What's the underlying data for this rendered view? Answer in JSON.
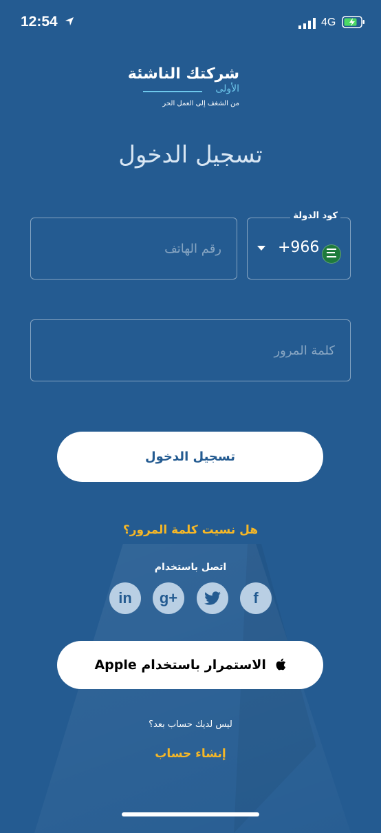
{
  "status_bar": {
    "time": "12:54",
    "network": "4G"
  },
  "logo": {
    "main": "شركتك الناشئة",
    "sub": "الأولى",
    "tagline": "من الشغف إلى العمل الحر"
  },
  "title": "تسجيل الدخول",
  "form": {
    "phone_placeholder": "رقم الهاتف",
    "country_label": "كود الدولة",
    "country_code": "+966",
    "password_placeholder": "كلمة المرور"
  },
  "login_button": "تسجيل الدخول",
  "forgot_password": "هل نسيت كلمة المرور؟",
  "connect_label": "اتصل باستخدام",
  "social": {
    "linkedin": "in",
    "google_plus": "g+",
    "facebook": "f"
  },
  "apple_button": "الاستمرار باستخدام Apple",
  "no_account": "ليس لديك حساب بعد؟",
  "create_account": "إنشاء حساب",
  "colors": {
    "background": "#245b91",
    "accent": "#f5b727",
    "logo_accent": "#6ec8ec"
  }
}
